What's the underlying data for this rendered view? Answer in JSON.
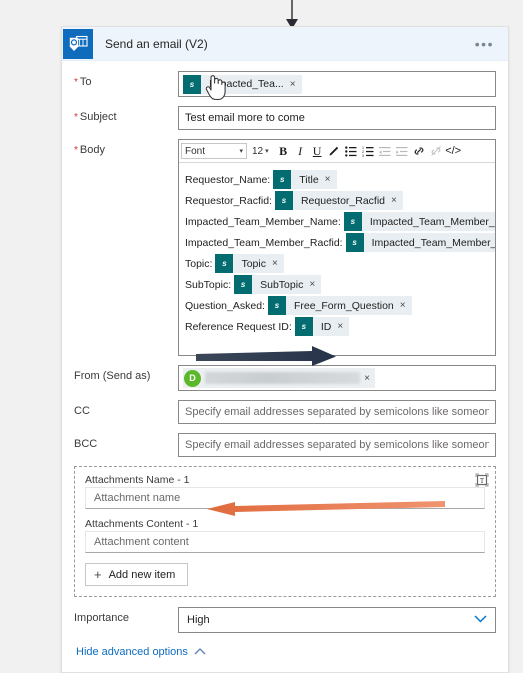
{
  "card": {
    "title": "Send an email (V2)",
    "app_icon": "outlook-email-icon",
    "overflow_menu": "•••",
    "header_bg": "#eef4fb",
    "icon_bg": "#0f6cbd"
  },
  "fields": {
    "to": {
      "label": "To",
      "required": true,
      "token": "Impacted_Tea...",
      "token_icon": "sharepoint-icon",
      "remove": "×"
    },
    "subject": {
      "label": "Subject",
      "required": true,
      "value": "Test email  more to come"
    },
    "body": {
      "label": "Body",
      "required": true,
      "toolbar": {
        "font_label": "Font",
        "font_caret": "▾",
        "size_label": "12",
        "size_caret": "▾",
        "bold": "B",
        "italic": "I",
        "underline": "U",
        "font_color": "pen-icon",
        "bulleted_list": "bulleted-list-icon",
        "numbered_list": "numbered-list-icon",
        "outdent": "outdent-icon",
        "indent": "indent-icon",
        "link": "link-icon",
        "unlink": "unlink-icon",
        "code_view": "</>"
      },
      "lines": [
        {
          "label": "Requestor_Name:",
          "token": "Title"
        },
        {
          "label": "Requestor_Racfid:",
          "token": "Requestor_Racfid"
        },
        {
          "label": "Impacted_Team_Member_Name:",
          "token": "Impacted_Team_Member_Name"
        },
        {
          "label": "Impacted_Team_Member_Racfid:",
          "token": "Impacted_Team_Member_Racfid"
        },
        {
          "label": "Topic:",
          "token": "Topic"
        },
        {
          "label": "SubTopic:",
          "token": "SubTopic"
        },
        {
          "label": "Question_Asked:",
          "token": "Free_Form_Question"
        },
        {
          "label": "Reference Request ID:",
          "token": "ID"
        }
      ]
    },
    "from": {
      "label": "From (Send as)",
      "avatar_initial": "D",
      "avatar_color": "#5cb82b",
      "value_redacted": true,
      "remove": "×"
    },
    "cc": {
      "label": "CC",
      "placeholder": "Specify email addresses separated by semicolons like someone@contoso.com"
    },
    "bcc": {
      "label": "BCC",
      "placeholder": "Specify email addresses separated by semicolons like someone@contoso.com"
    },
    "attachments": {
      "name_label": "Attachments Name - 1",
      "name_placeholder": "Attachment name",
      "content_label": "Attachments Content - 1",
      "content_placeholder": "Attachment content",
      "add_item_label": "Add new item",
      "add_item_plus": "+",
      "switch_input_icon": "text-mode-icon"
    },
    "importance": {
      "label": "Importance",
      "value": "High",
      "caret": "⌄"
    }
  },
  "footer": {
    "advanced_label": "Hide advanced options",
    "advanced_caret": "⌃",
    "link_color": "#0f6cbd"
  },
  "annotations": {
    "top_arrow": {
      "name": "down-arrow-annotation",
      "color": "#2b2b35",
      "direction": "down"
    },
    "from_arrow": {
      "name": "navy-right-arrow-annotation",
      "color": "#2e3a4f",
      "direction": "right"
    },
    "attachment_arrow": {
      "name": "orange-left-arrow-annotation",
      "color": "#e8794f",
      "direction": "left"
    },
    "cursor": {
      "name": "hand-cursor",
      "shape": "pointing-hand"
    }
  }
}
